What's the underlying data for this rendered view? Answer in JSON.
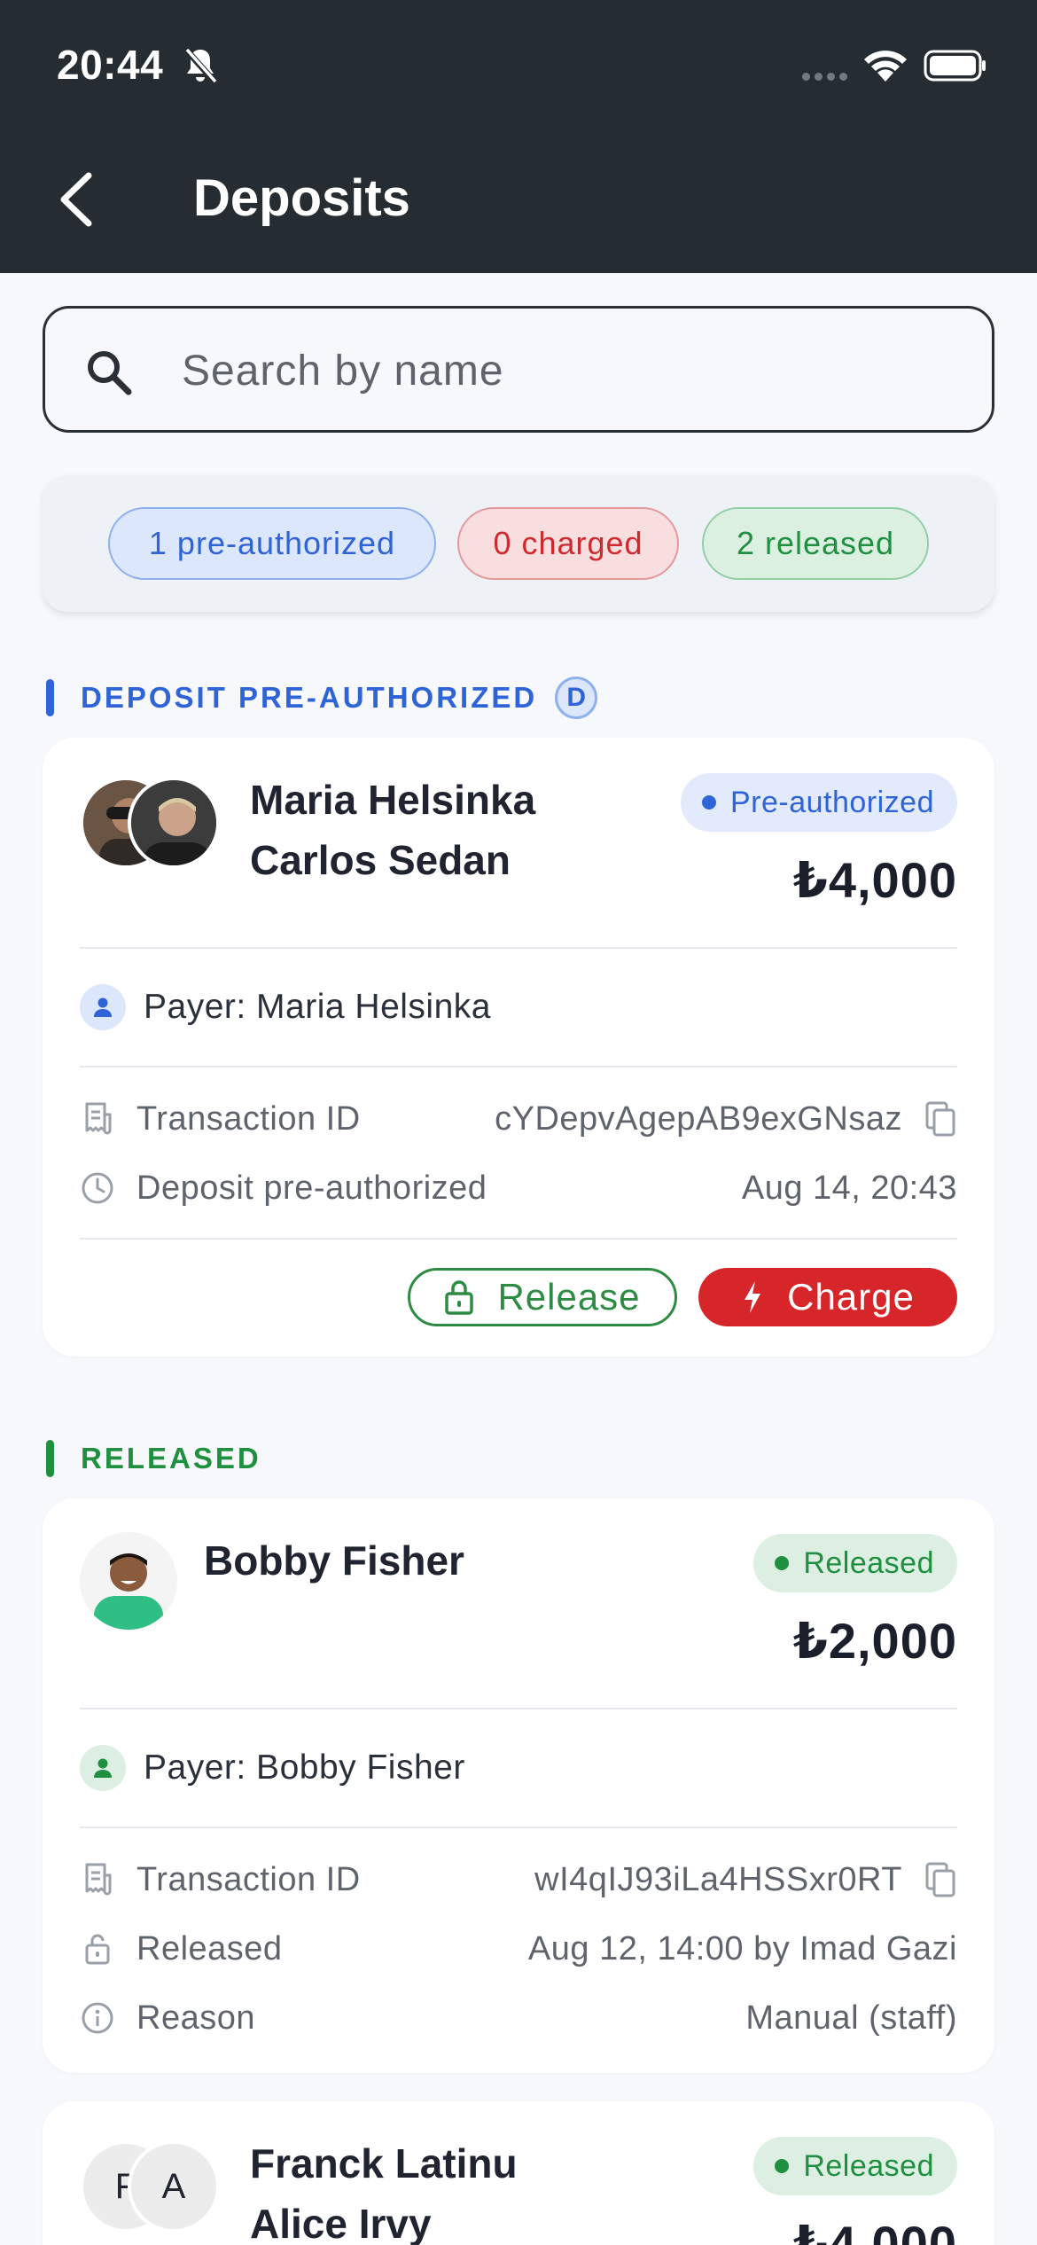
{
  "status_bar": {
    "time": "20:44"
  },
  "header": {
    "title": "Deposits"
  },
  "search": {
    "placeholder": "Search by name",
    "value": ""
  },
  "summary": {
    "pre_authorized": "1 pre-authorized",
    "charged": "0 charged",
    "released": "2 released"
  },
  "sections": [
    {
      "label": "DEPOSIT PRE-AUTHORIZED",
      "badge": "D",
      "color": "#2f63d8"
    },
    {
      "label": "RELEASED",
      "color": "#1f8f40"
    }
  ],
  "cards": [
    {
      "names": [
        "Maria Helsinka",
        "Carlos Sedan"
      ],
      "status": "Pre-authorized",
      "amount": "₺4,000",
      "payer": "Payer: Maria Helsinka",
      "details": [
        {
          "label": "Transaction ID",
          "value": "cYDepvAgepAB9exGNsaz",
          "icon": "receipt-icon"
        },
        {
          "label": "Deposit pre-authorized",
          "value": "Aug 14, 20:43",
          "icon": "clock-icon"
        }
      ],
      "actions": {
        "release": "Release",
        "charge": "Charge"
      }
    },
    {
      "names": [
        "Bobby Fisher"
      ],
      "status": "Released",
      "amount": "₺2,000",
      "payer": "Payer: Bobby Fisher",
      "details": [
        {
          "label": "Transaction ID",
          "value": "wI4qIJ93iLa4HSSxr0RT",
          "icon": "receipt-icon"
        },
        {
          "label": "Released",
          "value": "Aug 12, 14:00 by Imad Gazi",
          "icon": "lock-open-icon"
        },
        {
          "label": "Reason",
          "value": "Manual (staff)",
          "icon": "info-icon"
        }
      ]
    },
    {
      "names": [
        "Franck Latinu",
        "Alice Irvy"
      ],
      "initials": [
        "F",
        "A"
      ],
      "status": "Released",
      "amount": "₺4,000"
    }
  ]
}
